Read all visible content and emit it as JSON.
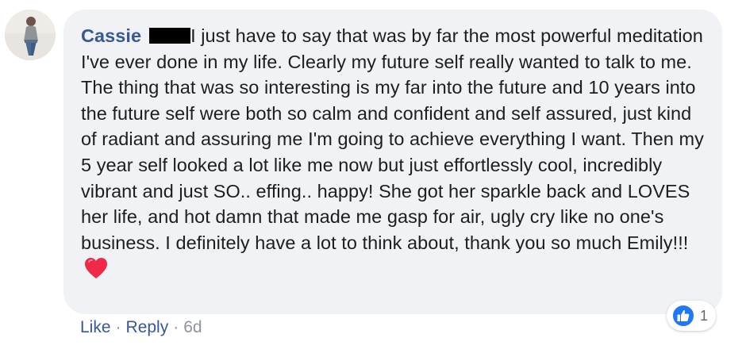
{
  "comment": {
    "author": "Cassie",
    "text": "I just have to say that was by far the most powerful meditation I've ever done in my life. Clearly my future self really wanted to talk to me. The thing that was so interesting is my far into the future and 10 years into the future self were both so calm and confident and self assured, just kind of radiant and assuring me I'm going to achieve everything I want. Then my 5 year self looked a lot like me now but just effortlessly cool, incredibly vibrant and just SO.. effing.. happy! She got her sparkle back and LOVES her life, and hot damn that made me gasp for air, ugly cry like no one's business. I definitely have a lot to think about, thank you so much Emily!!!",
    "emoji": "red-heart-icon",
    "reaction_icon": "thumbs-up-icon",
    "reaction_count": "1"
  },
  "actions": {
    "like_label": "Like",
    "separator": "·",
    "reply_label": "Reply",
    "timestamp": "6d"
  },
  "colors": {
    "bubble_bg": "#f0f2f5",
    "author_link": "#385898",
    "body_text": "#1c1e21",
    "muted": "#8d949e",
    "like_blue": "#2078f4",
    "heart_red": "#f02849"
  }
}
